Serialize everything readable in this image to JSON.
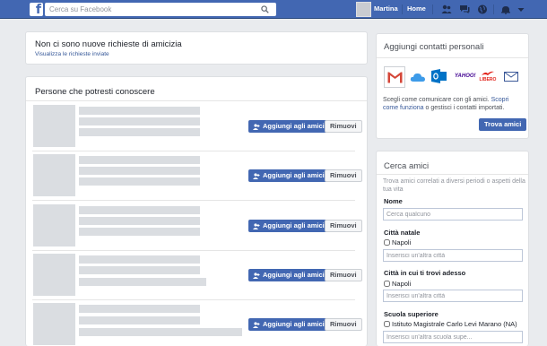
{
  "topbar": {
    "logo": "f",
    "search_placeholder": "Cerca su Facebook",
    "user_name": "Martina",
    "home_label": "Home"
  },
  "requests": {
    "title": "Non ci sono nuove richieste di amicizia",
    "link": "Visualizza le richieste inviate"
  },
  "suggestions": {
    "title": "Persone che potresti conoscere",
    "add_label": "Aggiungi agli amici",
    "remove_label": "Rimuovi",
    "rows": [
      {
        "add": "Aggiungi agli amici",
        "remove": "Rimuovi"
      },
      {
        "add": "Aggiungi agli amici",
        "remove": "Rimuovi"
      },
      {
        "add": "Aggiungi agli amici",
        "remove": "Rimuovi"
      },
      {
        "add": "Aggiungi agli amici",
        "remove": "Rimuovi"
      },
      {
        "add": "Aggiungi agli amici",
        "remove": "Rimuovi"
      }
    ]
  },
  "contacts": {
    "title": "Aggiungi contatti personali",
    "providers": [
      "gmail",
      "icloud",
      "outlook",
      "yahoo",
      "libero",
      "email"
    ],
    "yahoo_text": "YAHOO!",
    "libero_text": "LIBERO",
    "desc_prefix": "Scegli come comunicare con gli amici.",
    "desc_link": "Scopri come funziona",
    "desc_suffix": "o gestisci i contatti importati.",
    "button": "Trova amici"
  },
  "search_friends": {
    "title": "Cerca amici",
    "desc": "Trova amici correlati a diversi periodi o aspetti della tua vita",
    "name_label": "Nome",
    "name_placeholder": "Cerca qualcuno",
    "hometown_label": "Città natale",
    "hometown_option": "Napoli",
    "hometown_placeholder": "Inserisci un'altra città",
    "current_city_label": "Città in cui ti trovi adesso",
    "current_city_option": "Napoli",
    "current_city_placeholder": "Inserisci un'altra città",
    "school_label": "Scuola superiore",
    "school_option": "Istituto Magistrale Carlo Levi Marano (NA)",
    "school_placeholder": "Inserisci un'altra scuola supe..."
  },
  "colors": {
    "brand": "#4267b2",
    "background": "#e9ebee",
    "link": "#365899"
  }
}
